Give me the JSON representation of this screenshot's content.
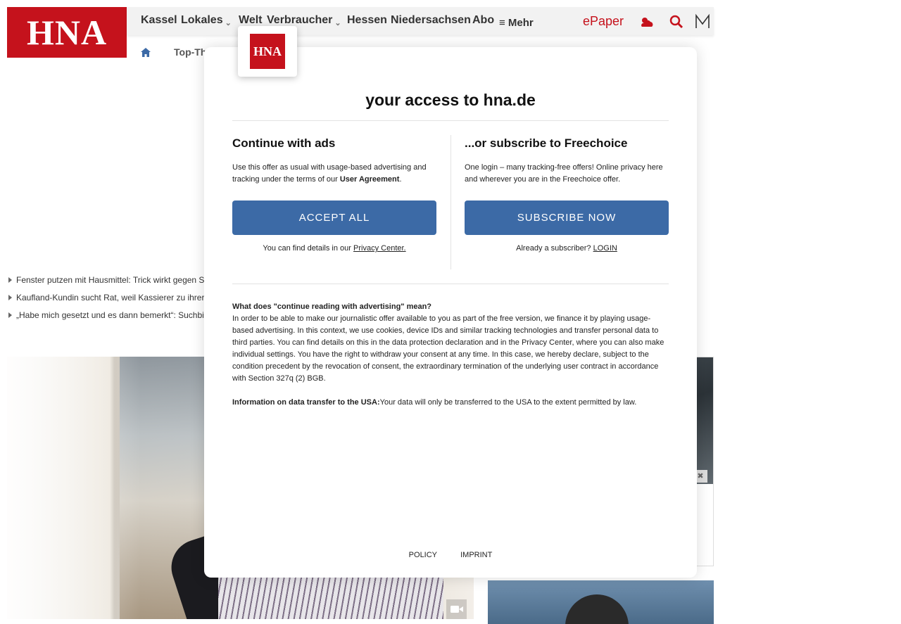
{
  "brand": {
    "logo_text": "HNA",
    "accent": "#c5121c",
    "button_color": "#3c6aa6"
  },
  "nav": {
    "items": [
      {
        "label": "Kassel",
        "dropdown": false
      },
      {
        "label": "Lokales",
        "dropdown": true
      },
      {
        "label": "Welt",
        "dropdown": false
      },
      {
        "label": "Verbraucher",
        "dropdown": true
      },
      {
        "label": "Hessen",
        "dropdown": false
      },
      {
        "label": "Niedersachsen",
        "dropdown": false
      },
      {
        "label": "Abo",
        "dropdown": false
      }
    ],
    "more_label": "Mehr",
    "epaper_label": "ePaper",
    "icons": [
      "weather-icon",
      "search-icon",
      "merkliste-icon"
    ]
  },
  "subnav": {
    "home_icon": "home-icon",
    "label": "Top-Th"
  },
  "teasers": [
    "Fenster putzen mit Hausmittel: Trick wirkt gegen S",
    "Kaufland-Kundin sucht Rat, weil Kassierer zu ihrer",
    "„Habe mich gesetzt und es dann bemerkt“: Suchbi"
  ],
  "hero": {
    "badge_icon": "video-camera-icon"
  },
  "sidebar": {
    "close_icon": "close-icon"
  },
  "modal": {
    "logo_text": "HNA",
    "title": "your access to hna.de",
    "left": {
      "heading": "Continue with ads",
      "desc_prefix": "Use this offer as usual with usage-based advertising and tracking under the terms of our ",
      "desc_bold": "User Agreement",
      "desc_suffix": ".",
      "button": "ACCEPT ALL",
      "note_prefix": "You can find details in our ",
      "note_link": "Privacy Center."
    },
    "right": {
      "heading": "...or subscribe to Freechoice",
      "desc": "One login – many tracking-free offers! Online privacy here and wherever you are in the Freechoice offer.",
      "button": "SUBSCRIBE NOW",
      "note_prefix": "Already a subscriber? ",
      "note_link": "LOGIN"
    },
    "info1_title": "What does \"continue reading with advertising\" mean?",
    "info1_body": "In order to be able to make our journalistic offer available to you as part of the free version, we finance it by playing usage-based advertising. In this context, we use cookies, device IDs and similar tracking technologies and transfer personal data to third parties. You can find details on this in the data protection declaration and in the Privacy Center, where you can also make individual settings. You have the right to withdraw your consent at any time. In this case, we hereby declare, subject to the condition precedent by the revocation of consent, the extraordinary termination of the underlying user contract in accordance with Section 327q (2) BGB.",
    "info2_title": "Information on data transfer to the USA:",
    "info2_body": "Your data will only be transferred to the USA to the extent permitted by law.",
    "footer": {
      "policy": "POLICY",
      "imprint": "IMPRINT"
    }
  }
}
